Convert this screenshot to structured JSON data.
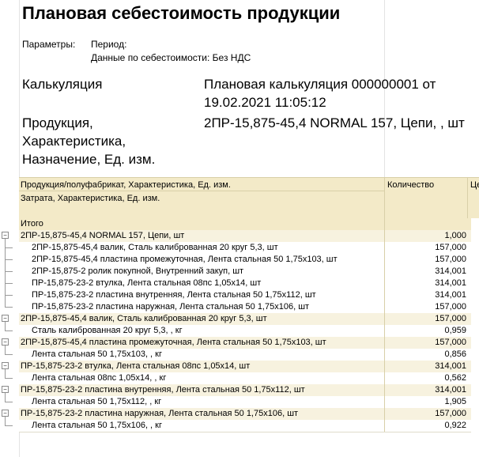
{
  "title": "Плановая себестоимость продукции",
  "params": {
    "label": "Параметры:",
    "period": "Период:",
    "cost_data": "Данные по себестоимости: Без НДС"
  },
  "calc": {
    "label": "Калькуляция",
    "value": "Плановая калькуляция 000000001 от 19.02.2021 11:05:12"
  },
  "product": {
    "label": "Продукция, Характеристика, Назначение, Ед. изм.",
    "value": "2ПР-15,875-45,4 NORMAL 157, Цепи, , шт"
  },
  "table": {
    "headers": {
      "product": "Продукция/полуфабрикат, Характеристика, Ед. изм.",
      "cost": "Затрата, Характеристика, Ед. изм.",
      "qty": "Количество",
      "next": "Це"
    },
    "rows": [
      {
        "type": "total",
        "text": "Итого",
        "qty": ""
      },
      {
        "type": "group",
        "text": "2ПР-15,875-45,4 NORMAL 157, Цепи, шт",
        "qty": "1,000"
      },
      {
        "type": "sub",
        "text": "2ПР-15,875-45,4 валик, Сталь калиброванная 20 круг 5,3, шт",
        "qty": "157,000"
      },
      {
        "type": "sub",
        "text": "2ПР-15,875-45,4 пластина промежуточная, Лента стальная 50 1,75х103, шт",
        "qty": "157,000"
      },
      {
        "type": "sub",
        "text": "2ПР-15,875-2 ролик покупной, Внутренний закуп, шт",
        "qty": "314,001"
      },
      {
        "type": "sub",
        "text": "ПР-15,875-23-2 втулка, Лента стальная 08пс 1,05х14, шт",
        "qty": "314,001"
      },
      {
        "type": "sub",
        "text": "ПР-15,875-23-2 пластина внутренняя, Лента стальная 50 1,75х112, шт",
        "qty": "314,001"
      },
      {
        "type": "sub",
        "text": "ПР-15,875-23-2 пластина наружная, Лента стальная 50 1,75х106, шт",
        "qty": "157,000"
      },
      {
        "type": "group",
        "text": "2ПР-15,875-45,4 валик, Сталь калиброванная 20 круг 5,3, шт",
        "qty": "157,000"
      },
      {
        "type": "sub",
        "text": "Сталь калиброванная 20 круг 5,3, , кг",
        "qty": "0,959"
      },
      {
        "type": "group",
        "text": "2ПР-15,875-45,4 пластина промежуточная, Лента стальная 50 1,75х103, шт",
        "qty": "157,000"
      },
      {
        "type": "sub",
        "text": "Лента стальная 50 1,75х103, , кг",
        "qty": "0,856"
      },
      {
        "type": "group",
        "text": "ПР-15,875-23-2 втулка, Лента стальная 08пс 1,05х14, шт",
        "qty": "314,001"
      },
      {
        "type": "sub",
        "text": "Лента стальная 08пс 1,05х14, , кг",
        "qty": "0,562"
      },
      {
        "type": "group",
        "text": "ПР-15,875-23-2 пластина внутренняя, Лента стальная 50 1,75х112, шт",
        "qty": "314,001"
      },
      {
        "type": "sub",
        "text": "Лента стальная 50 1,75х112, , кг",
        "qty": "1,905"
      },
      {
        "type": "group",
        "text": "ПР-15,875-23-2 пластина наружная, Лента стальная 50 1,75х106, шт",
        "qty": "157,000"
      },
      {
        "type": "sub",
        "text": "Лента стальная 50 1,75х106, , кг",
        "qty": "0,922"
      }
    ]
  },
  "icons": {
    "collapse": "collapse-minus-icon"
  }
}
